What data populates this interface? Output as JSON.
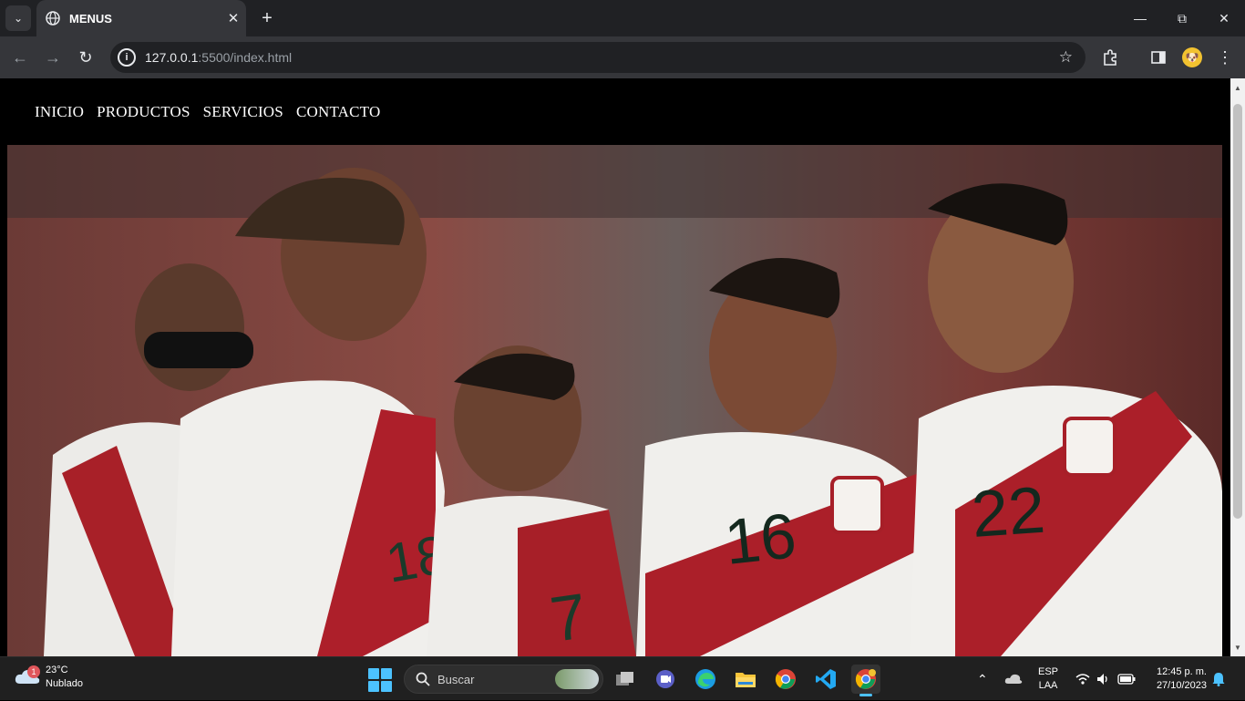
{
  "browser": {
    "tab_title": "MENUS",
    "url_host": "127.0.0.1",
    "url_rest": ":5500/index.html"
  },
  "page": {
    "menu": [
      {
        "label": "INICIO"
      },
      {
        "label": "PRODUCTOS"
      },
      {
        "label": "SERVICIOS"
      },
      {
        "label": "CONTACTO"
      }
    ],
    "hero": {
      "description_icon": "photo-of-peru-football-team",
      "jersey_numbers": [
        "18",
        "7",
        "16",
        "22"
      ],
      "colors": {
        "red": "#b0202a",
        "white": "#f2f0ee"
      }
    }
  },
  "taskbar": {
    "weather_temp": "23°C",
    "weather_desc": "Nublado",
    "weather_badge": "1",
    "search_placeholder": "Buscar",
    "lang_top": "ESP",
    "lang_bottom": "LAA",
    "time": "12:45 p. m.",
    "date": "27/10/2023"
  }
}
